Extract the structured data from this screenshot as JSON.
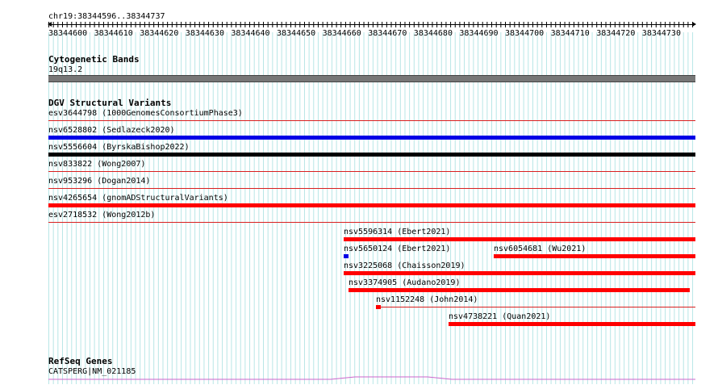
{
  "coordinates": {
    "region_label": "chr19:38344596..38344737",
    "ticks": [
      "38344600",
      "38344610",
      "38344620",
      "38344630",
      "38344640",
      "38344650",
      "38344660",
      "38344670",
      "38344680",
      "38344690",
      "38344700",
      "38344710",
      "38344720",
      "38344730"
    ]
  },
  "cytoband_track": {
    "title": "Cytogenetic Bands",
    "band_label": "19q13.2"
  },
  "dgv_track": {
    "title": "DGV Structural Variants",
    "variants": [
      {
        "label": "esv3644798 (1000GenomesConsortiumPhase3)",
        "color": "#cc0000",
        "bar": "none"
      },
      {
        "label": "nsv6528802 (Sedlazeck2020)",
        "color": "#0000e6",
        "bar": "full"
      },
      {
        "label": "nsv5556604 (ByrskaBishop2022)",
        "color": "#000000",
        "bar": "full"
      },
      {
        "label": "nsv833822 (Wong2007)",
        "color": "#cc0000",
        "bar": "none"
      },
      {
        "label": "nsv953296 (Dogan2014)",
        "color": "#cc0000",
        "bar": "none"
      },
      {
        "label": "nsv4265654 (gnomADStructuralVariants)",
        "color": "#ff0000",
        "bar": "full"
      },
      {
        "label": "esv2718532 (Wong2012b)",
        "color": "#cc0000",
        "bar": "none"
      },
      {
        "label": "nsv5596314 (Ebert2021)",
        "color": "#ff0000",
        "bar": "partial"
      },
      {
        "label": "nsv5650124 (Ebert2021)",
        "color": "#0000e6",
        "bar": "tiny"
      },
      {
        "label": "nsv6054681 (Wu2021)",
        "color": "#ff0000",
        "bar": "partial"
      },
      {
        "label": "nsv3225068 (Chaisson2019)",
        "color": "#ff0000",
        "bar": "partial"
      },
      {
        "label": "nsv3374905 (Audano2019)",
        "color": "#ff0000",
        "bar": "partial"
      },
      {
        "label": "nsv1152248 (John2014)",
        "color": "#ff0000",
        "bar": "tiny"
      },
      {
        "label": "nsv4738221 (Quan2021)",
        "color": "#ff0000",
        "bar": "partial"
      }
    ]
  },
  "refseq_track": {
    "title": "RefSeq Genes",
    "gene_label": "CATSPERG|NM_021185",
    "color": "#cc66cc"
  }
}
